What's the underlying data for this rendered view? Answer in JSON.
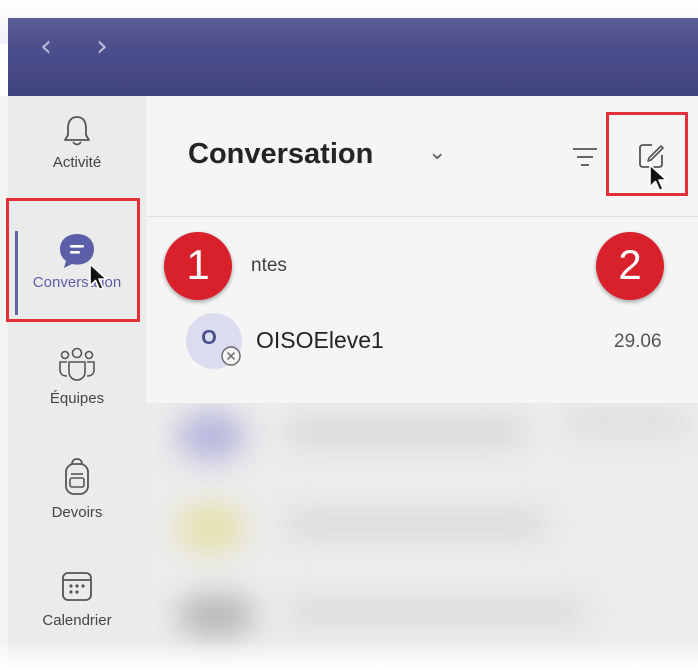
{
  "titlebar": {
    "back_glyph": "‹",
    "forward_glyph": "›"
  },
  "rail": {
    "items": [
      {
        "label": "Activité",
        "icon": "bell-icon"
      },
      {
        "label": "Conversation",
        "icon": "chat-icon",
        "active": true
      },
      {
        "label": "Équipes",
        "icon": "teams-icon"
      },
      {
        "label": "Devoirs",
        "icon": "backpack-icon"
      },
      {
        "label": "Calendrier",
        "icon": "calendar-icon"
      }
    ]
  },
  "panel": {
    "title": "Conversation",
    "title_chevron": "⌄",
    "section_label": "ntes"
  },
  "chats": [
    {
      "avatar_initial": "O",
      "name": "OISOEleve1",
      "date": "29.06"
    }
  ],
  "callouts": {
    "step1": "1",
    "step2": "2"
  },
  "colors": {
    "accent": "#6264a7",
    "callout_red": "#d8212b",
    "titlebar": "#464a88"
  }
}
